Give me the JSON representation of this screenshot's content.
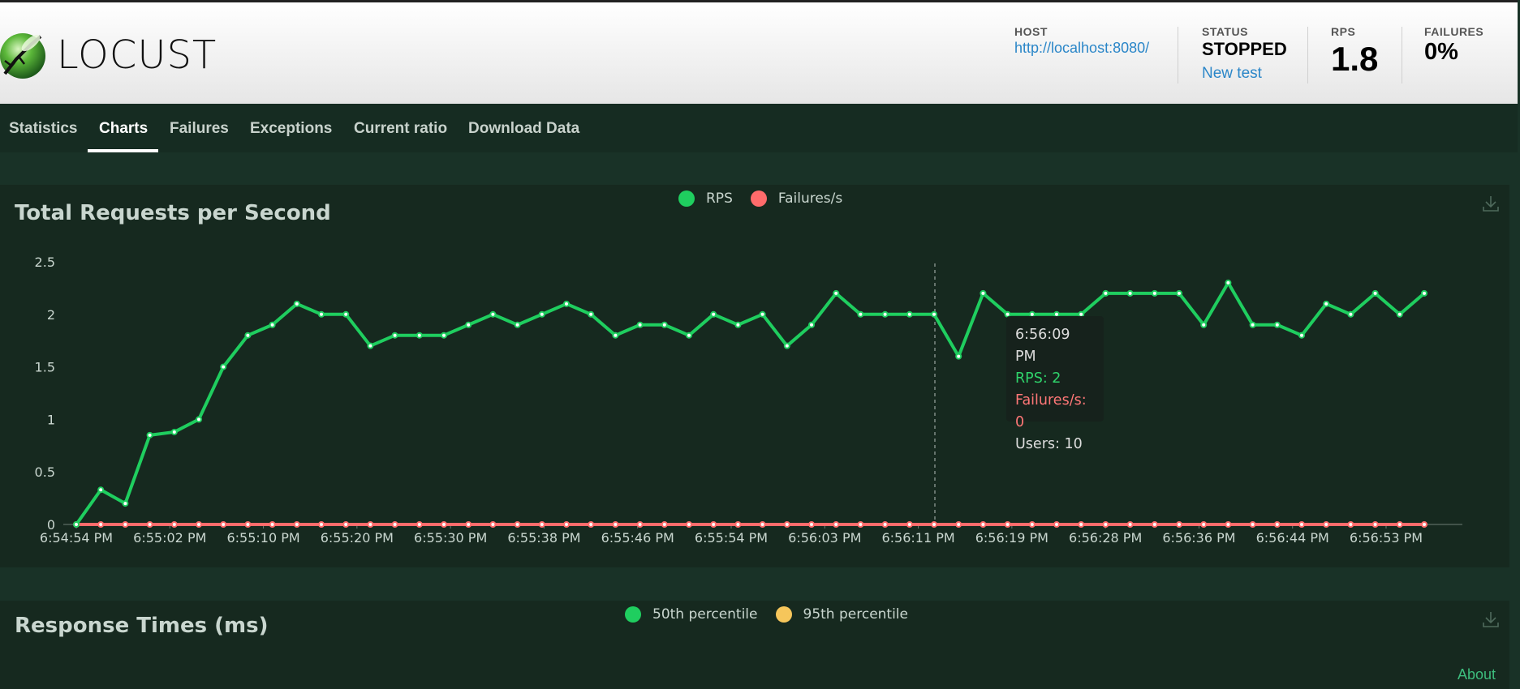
{
  "header": {
    "logo_text": "LOCUST",
    "host_label": "HOST",
    "host_value": "http://localhost:8080/",
    "status_label": "STATUS",
    "status_value": "STOPPED",
    "new_test_label": "New test",
    "rps_label": "RPS",
    "rps_value": "1.8",
    "failures_label": "FAILURES",
    "failures_value": "0%"
  },
  "nav": {
    "tabs": [
      {
        "label": "Statistics",
        "active": false
      },
      {
        "label": "Charts",
        "active": true
      },
      {
        "label": "Failures",
        "active": false
      },
      {
        "label": "Exceptions",
        "active": false
      },
      {
        "label": "Current ratio",
        "active": false
      },
      {
        "label": "Download Data",
        "active": false
      }
    ]
  },
  "colors": {
    "rps": "#1fce5f",
    "failures": "#ff6b6b",
    "p50": "#1fce5f",
    "p95": "#f6c65b",
    "accent_link": "#2a86c8"
  },
  "chart_rps": {
    "legend": [
      "RPS",
      "Failures/s"
    ]
  },
  "chart_response": {
    "title": "Response Times (ms)",
    "legend": [
      "50th percentile",
      "95th percentile"
    ]
  },
  "tooltip": {
    "time": "6:56:09 PM",
    "rps": "RPS: 2",
    "failures": "Failures/s: 0",
    "users": "Users: 10"
  },
  "footer": {
    "about": "About"
  },
  "chart_data": [
    {
      "type": "line",
      "title": "Total Requests per Second",
      "ylim": [
        0,
        2.5
      ],
      "yticks": [
        "0",
        "0.5",
        "1",
        "1.5",
        "2",
        "2.5"
      ],
      "xtick_labels": [
        "6:54:54 PM",
        "6:55:02 PM",
        "6:55:10 PM",
        "6:55:20 PM",
        "6:55:30 PM",
        "6:55:38 PM",
        "6:55:46 PM",
        "6:55:54 PM",
        "6:56:03 PM",
        "6:56:11 PM",
        "6:56:19 PM",
        "6:56:28 PM",
        "6:56:36 PM",
        "6:56:44 PM",
        "6:56:53 PM"
      ],
      "highlight_index": 35,
      "series": [
        {
          "name": "RPS",
          "values": [
            0,
            0.33,
            0.2,
            0.85,
            0.88,
            1.0,
            1.5,
            1.8,
            1.9,
            2.1,
            2.0,
            2.0,
            1.7,
            1.8,
            1.8,
            1.8,
            1.9,
            2.0,
            1.9,
            2.0,
            2.1,
            2.0,
            1.8,
            1.9,
            1.9,
            1.8,
            2.0,
            1.9,
            2.0,
            1.7,
            1.9,
            2.2,
            2.0,
            2.0,
            2.0,
            2.0,
            1.6,
            2.2,
            2.0,
            2.0,
            2.0,
            2.0,
            2.2,
            2.2,
            2.2,
            2.2,
            1.9,
            2.3,
            1.9,
            1.9,
            1.8,
            2.1,
            2.0,
            2.2,
            2.0,
            2.2
          ]
        },
        {
          "name": "Failures/s",
          "values": [
            0,
            0,
            0,
            0,
            0,
            0,
            0,
            0,
            0,
            0,
            0,
            0,
            0,
            0,
            0,
            0,
            0,
            0,
            0,
            0,
            0,
            0,
            0,
            0,
            0,
            0,
            0,
            0,
            0,
            0,
            0,
            0,
            0,
            0,
            0,
            0,
            0,
            0,
            0,
            0,
            0,
            0,
            0,
            0,
            0,
            0,
            0,
            0,
            0,
            0,
            0,
            0,
            0,
            0,
            0,
            0
          ]
        }
      ]
    }
  ]
}
